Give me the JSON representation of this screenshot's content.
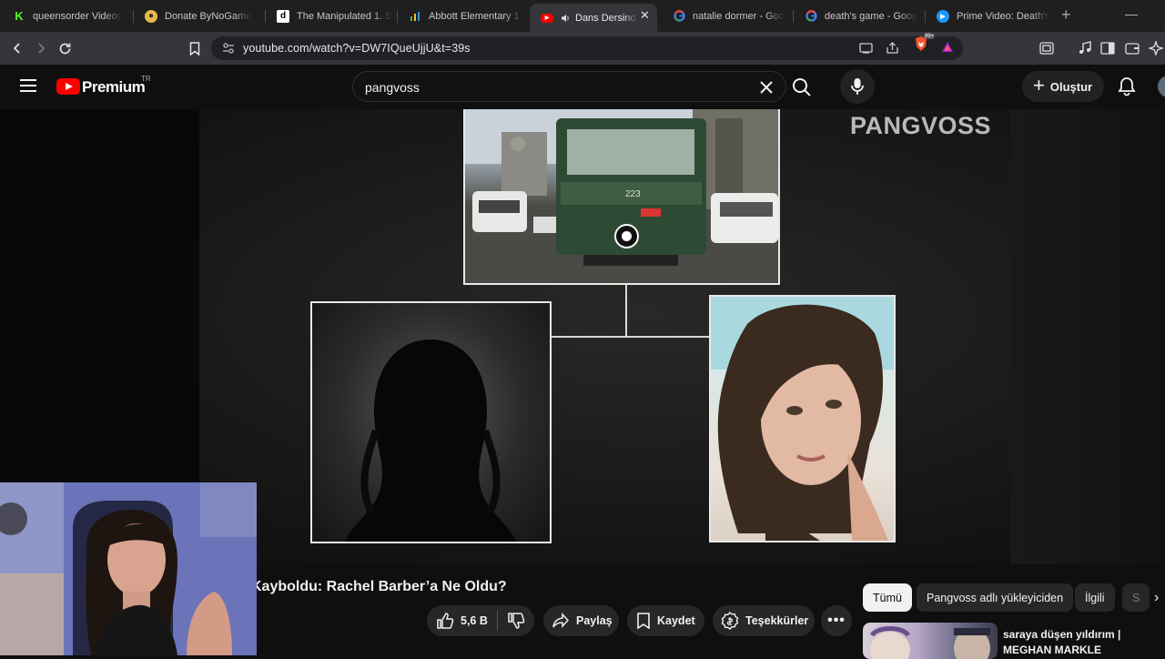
{
  "browser": {
    "tabs": [
      {
        "title": "queensorder Videos",
        "favicon": "k-icon"
      },
      {
        "title": "Donate ByNoGame",
        "favicon": "bynogame-icon"
      },
      {
        "title": "The Manipulated 1. S",
        "favicon": "d-icon"
      },
      {
        "title": "Abbott Elementary 1.",
        "favicon": "bars-icon"
      },
      {
        "title": "Dans Dersind",
        "favicon": "youtube-icon",
        "active": true
      },
      {
        "title": "natalie dormer - Goo",
        "favicon": "google-icon"
      },
      {
        "title": "death's game - Goog",
        "favicon": "google-icon"
      },
      {
        "title": "Prime Video: Death's",
        "favicon": "prime-icon"
      }
    ],
    "url": "youtube.com/watch?v=DW7IQueUjjU&t=39s",
    "brave_badge": "99+"
  },
  "youtube": {
    "brand": "Premium",
    "region": "TR",
    "search_query": "pangvoss",
    "create_label": "Oluştur"
  },
  "video": {
    "watermark": "PANGVOSS",
    "tram_number": "223",
    "title": "Kayboldu: Rachel Barber’a Ne Oldu?",
    "like_count": "5,6 B",
    "actions": {
      "share": "Paylaş",
      "save": "Kaydet",
      "thanks": "Teşekkürler"
    }
  },
  "sidebar": {
    "chips": [
      "Tümü",
      "Pangvoss adlı yükleyiciden",
      "İlgili",
      "S"
    ],
    "recommendation": {
      "title_line1": "saraya düşen yıldırım |",
      "title_line2": "MEGHAN MARKLE"
    }
  },
  "colors": {
    "yt_red": "#ff0000",
    "background": "#0f0f0f",
    "chip_bg": "#272727"
  }
}
